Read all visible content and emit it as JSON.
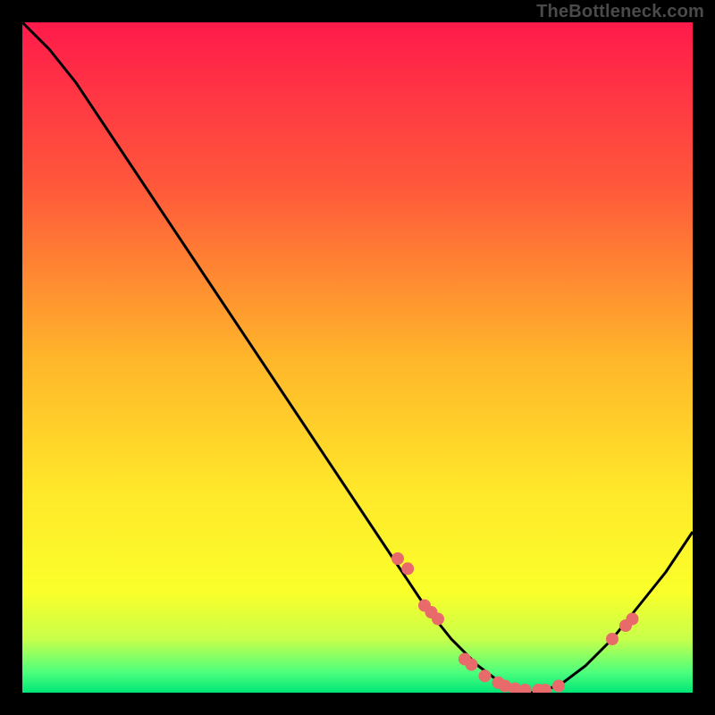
{
  "watermark": "TheBottleneck.com",
  "chart_data": {
    "type": "line",
    "title": "",
    "xlabel": "",
    "ylabel": "",
    "xlim": [
      0,
      100
    ],
    "ylim": [
      0,
      100
    ],
    "grid": false,
    "legend": false,
    "series": [
      {
        "name": "bottleneck-curve",
        "x": [
          0,
          4,
          8,
          12,
          16,
          20,
          24,
          28,
          32,
          36,
          40,
          44,
          48,
          52,
          56,
          60,
          64,
          68,
          72,
          76,
          80,
          84,
          88,
          92,
          96,
          100
        ],
        "y": [
          100,
          96,
          91,
          85,
          79,
          73,
          67,
          61,
          55,
          49,
          43,
          37,
          31,
          25,
          19,
          13,
          8,
          4,
          1,
          0,
          1,
          4,
          8,
          13,
          18,
          24
        ]
      }
    ],
    "highlight_points": {
      "name": "markers",
      "x": [
        56,
        57.5,
        60,
        61,
        62,
        66,
        67,
        69,
        71,
        72,
        73.5,
        75,
        77,
        78,
        80,
        88,
        90,
        91
      ],
      "y": [
        20,
        18.5,
        13,
        12,
        11,
        5,
        4.2,
        2.5,
        1.5,
        1,
        0.6,
        0.4,
        0.4,
        0.4,
        1,
        8,
        10,
        11
      ]
    },
    "background_gradient": {
      "stops": [
        {
          "offset": 0.0,
          "color": "#ff1a4b"
        },
        {
          "offset": 0.25,
          "color": "#ff5a3a"
        },
        {
          "offset": 0.5,
          "color": "#ffb52a"
        },
        {
          "offset": 0.7,
          "color": "#ffe82a"
        },
        {
          "offset": 0.85,
          "color": "#faff2a"
        },
        {
          "offset": 0.92,
          "color": "#c8ff4a"
        },
        {
          "offset": 0.97,
          "color": "#4cff7d"
        },
        {
          "offset": 1.0,
          "color": "#00e676"
        }
      ]
    },
    "marker_color": "#e86a6a",
    "line_color": "#000000"
  }
}
